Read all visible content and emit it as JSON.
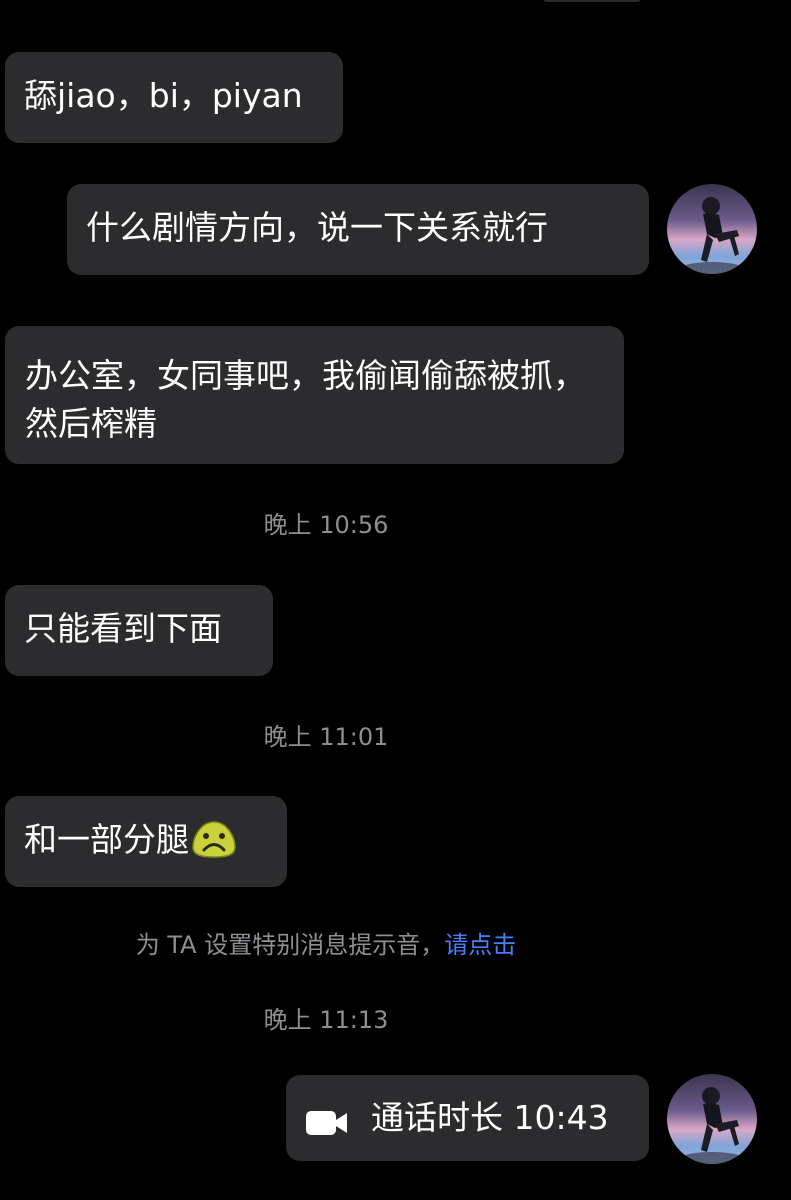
{
  "messages": [
    {
      "text": "舔jiao，bi，piyan"
    },
    {
      "text": "什么剧情方向，说一下关系就行"
    },
    {
      "text": "办公室，女同事吧，我偷闻偷舔被抓，然后榨精"
    },
    {
      "text": "只能看到下面"
    },
    {
      "text": "和一部分腿",
      "emoji": "frowning-face-emoji"
    }
  ],
  "timestamps": [
    "晚上 10:56",
    "晚上 11:01",
    "晚上 11:13"
  ],
  "system_notice": {
    "text": "为 TA 设置特别消息提示音，",
    "link": "请点击"
  },
  "call": {
    "icon": "video-camera-icon",
    "label": "通话时长 10:43"
  },
  "colors": {
    "background": "#000000",
    "bubble": "#2c2c2e",
    "timestamp": "#8e8e93",
    "link": "#4a7dff"
  }
}
